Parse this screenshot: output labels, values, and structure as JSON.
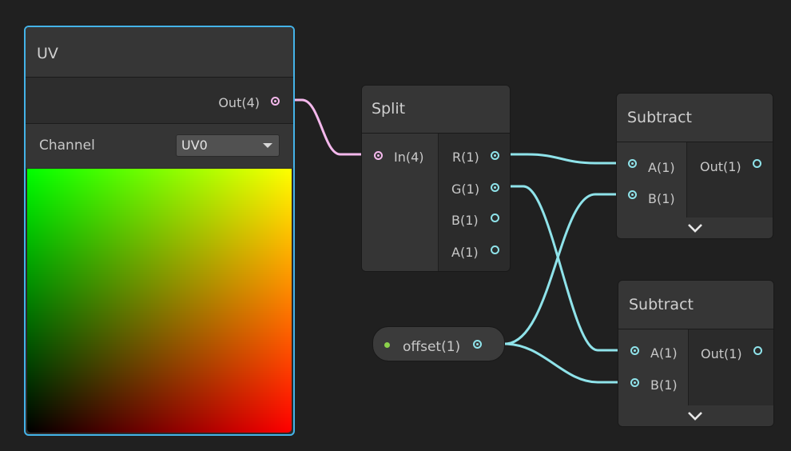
{
  "uv_node": {
    "title": "UV",
    "output": "Out(4)",
    "channel_label": "Channel",
    "channel_value": "UV0",
    "preview_colors": [
      "#00ff00",
      "#ffff00",
      "#000000",
      "#ff0000"
    ]
  },
  "split_node": {
    "title": "Split",
    "input": "In(4)",
    "outputs": [
      "R(1)",
      "G(1)",
      "B(1)",
      "A(1)"
    ]
  },
  "subtract_node_1": {
    "title": "Subtract",
    "inputs": [
      "A(1)",
      "B(1)"
    ],
    "output": "Out(1)"
  },
  "subtract_node_2": {
    "title": "Subtract",
    "inputs": [
      "A(1)",
      "B(1)"
    ],
    "output": "Out(1)"
  },
  "property_node": {
    "label": "offset(1)"
  },
  "colors": {
    "background": "#202020",
    "selection": "#44b3e8",
    "vector4_wire": "#f4b8ec",
    "float_wire": "#8fe3ea",
    "property_dot": "#8bd14b"
  },
  "icons": [
    "dropdown-arrow-icon",
    "collapse-chevron-icon",
    "port-icon"
  ]
}
